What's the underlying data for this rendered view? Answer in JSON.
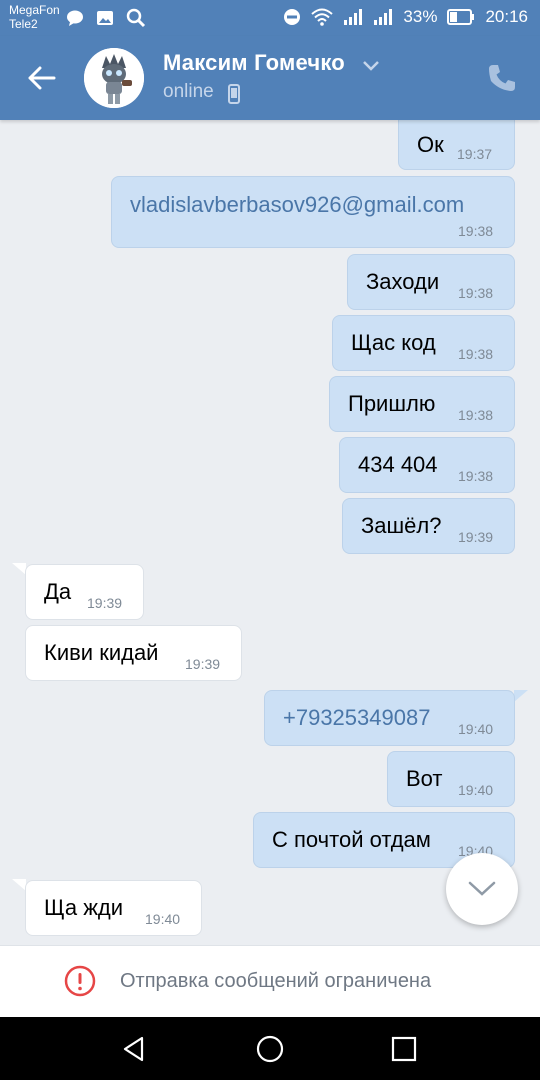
{
  "status_bar": {
    "carrier1": "MegaFon",
    "carrier2": "Tele2",
    "battery": "33%",
    "time": "20:16"
  },
  "header": {
    "contact_name": "Максим Гомечко",
    "status": "online",
    "icons": [
      "back-arrow-icon",
      "chevron-down-icon",
      "mobile-phone-icon",
      "call-icon"
    ]
  },
  "messages": [
    {
      "text": "Ок",
      "time": "19:37",
      "dir": "out"
    },
    {
      "text": "vladislavberbasov926@gmail.com",
      "time": "19:38",
      "dir": "out",
      "link": true
    },
    {
      "text": "Заходи",
      "time": "19:38",
      "dir": "out"
    },
    {
      "text": "Щас код",
      "time": "19:38",
      "dir": "out"
    },
    {
      "text": "Пришлю",
      "time": "19:38",
      "dir": "out"
    },
    {
      "text": "434 404",
      "time": "19:38",
      "dir": "out"
    },
    {
      "text": "Зашёл?",
      "time": "19:39",
      "dir": "out"
    },
    {
      "text": "Да",
      "time": "19:39",
      "dir": "in"
    },
    {
      "text": "Киви кидай",
      "time": "19:39",
      "dir": "in"
    },
    {
      "text": "+79325349087",
      "time": "19:40",
      "dir": "out",
      "link": true
    },
    {
      "text": "Вот",
      "time": "19:40",
      "dir": "out"
    },
    {
      "text": "С почтой отдам",
      "time": "19:40",
      "dir": "out"
    },
    {
      "text": "Ща жди",
      "time": "19:40",
      "dir": "in"
    }
  ],
  "restricted": {
    "text": "Отправка сообщений ограничена"
  },
  "colors": {
    "header": "#5181b8",
    "outgoing_bubble": "#cce0f5",
    "incoming_bubble": "#ffffff",
    "background": "#ebeef2",
    "warning": "#e64646"
  }
}
